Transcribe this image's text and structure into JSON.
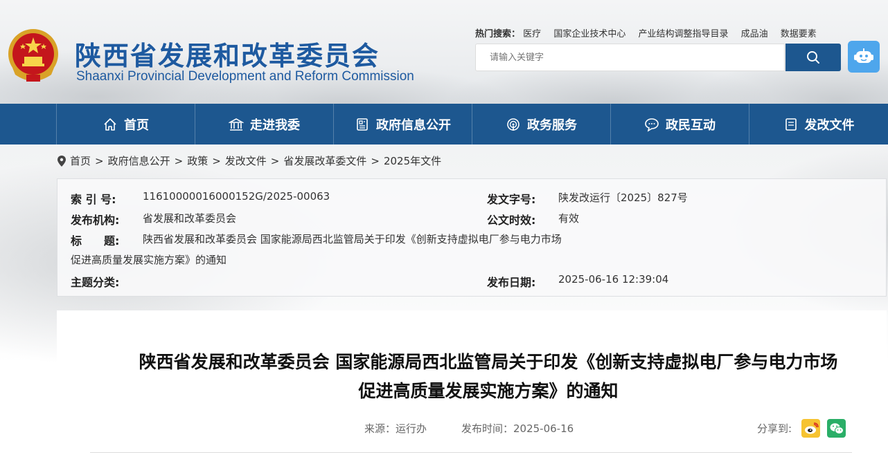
{
  "header": {
    "title_cn": "陕西省发展和改革委员会",
    "title_en": "Shaanxi Provincial Development and Reform Commission",
    "hot_label": "热门搜索：",
    "hot_links": [
      "医疗",
      "国家企业技术中心",
      "产业结构调整指导目录",
      "成品油",
      "数据要素"
    ],
    "search_placeholder": "请输入关键字"
  },
  "nav": {
    "items": [
      {
        "label": "首页",
        "icon": "home-icon"
      },
      {
        "label": "走进我委",
        "icon": "building-icon"
      },
      {
        "label": "政府信息公开",
        "icon": "document-icon"
      },
      {
        "label": "政务服务",
        "icon": "service-icon"
      },
      {
        "label": "政民互动",
        "icon": "chat-icon"
      },
      {
        "label": "发改文件",
        "icon": "file-icon"
      }
    ]
  },
  "breadcrumb": [
    "首页",
    "政府信息公开",
    "政策",
    "发改文件",
    "省发展改革委文件",
    "2025年文件"
  ],
  "meta": {
    "index_label": "索 引 号:",
    "index_value": "11610000016000152G/2025-00063",
    "doc_no_label": "发文字号:",
    "doc_no_value": "陕发改运行〔2025〕827号",
    "org_label": "发布机构:",
    "org_value": "省发展和改革委员会",
    "validity_label": "公文时效:",
    "validity_value": "有效",
    "title_label": "标　　题:",
    "title_value_line1": "陕西省发展和改革委员会 国家能源局西北监管局关于印发《创新支持虚拟电厂参与电力市场",
    "title_value_line2": "促进高质量发展实施方案》的通知",
    "topic_label": "主题分类:",
    "topic_value": "",
    "date_label": "发布日期:",
    "date_value": "2025-06-16 12:39:04"
  },
  "article": {
    "title_line1": "陕西省发展和改革委员会 国家能源局西北监管局关于印发《创新支持虚拟电厂参与电力市场",
    "title_line2": "促进高质量发展实施方案》的通知",
    "source": "来源：运行办",
    "publish_time": "发布时间：2025-06-16",
    "share_label": "分享到:"
  },
  "colors": {
    "brand_blue": "#1d578f",
    "title_blue": "#1e5aa0",
    "robot_blue": "#4ea6ec",
    "weibo_yellow": "#f6c331",
    "wechat_green": "#2aae67"
  }
}
